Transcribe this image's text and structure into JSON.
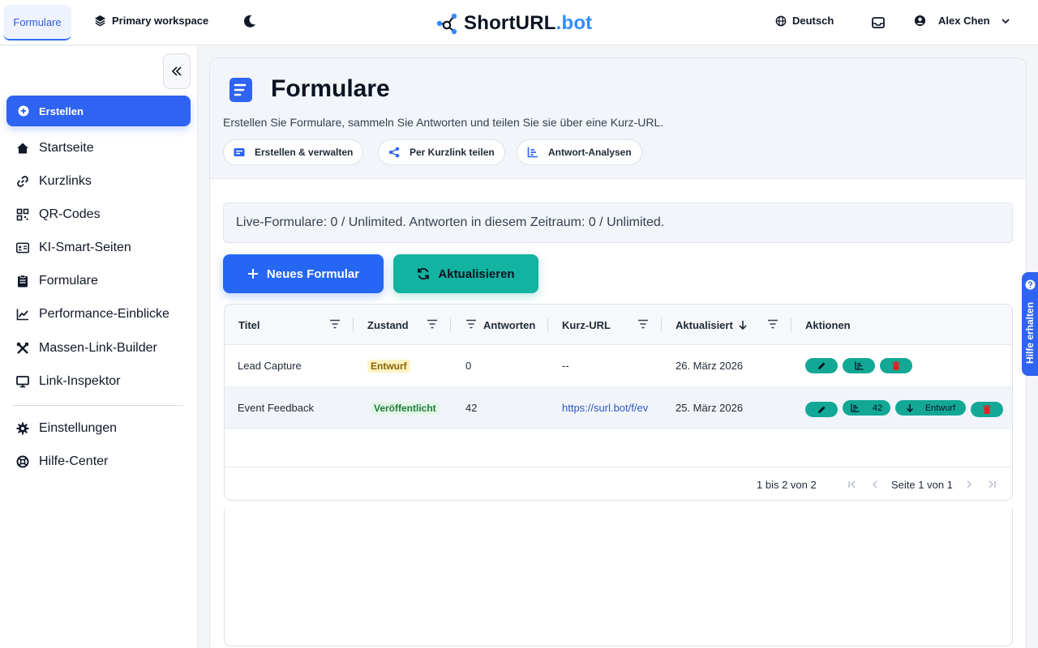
{
  "header": {
    "active_tab": "Formulare",
    "workspace": "Primary workspace",
    "brand_main": "ShortURL",
    "brand_accent": ".bot",
    "language": "Deutsch",
    "user_name": "Alex Chen"
  },
  "sidebar": {
    "create_label": "Erstellen",
    "items": [
      {
        "label": "Startseite",
        "icon": "home-icon"
      },
      {
        "label": "Kurzlinks",
        "icon": "link-icon"
      },
      {
        "label": "QR-Codes",
        "icon": "qr-code-icon"
      },
      {
        "label": "KI-Smart-Seiten",
        "icon": "id-card-icon"
      },
      {
        "label": "Formulare",
        "icon": "clipboard-icon"
      },
      {
        "label": "Performance-Einblicke",
        "icon": "chart-line-icon"
      },
      {
        "label": "Massen-Link-Builder",
        "icon": "tools-icon"
      },
      {
        "label": "Link-Inspektor",
        "icon": "monitor-icon"
      }
    ],
    "bottom_items": [
      {
        "label": "Einstellungen",
        "icon": "gear-icon"
      },
      {
        "label": "Hilfe-Center",
        "icon": "lifebuoy-icon"
      }
    ]
  },
  "page": {
    "title": "Formulare",
    "subtitle": "Erstellen Sie Formulare, sammeln Sie Antworten und teilen Sie sie über eine Kurz-URL.",
    "chips": [
      "Erstellen & verwalten",
      "Per Kurzlink teilen",
      "Antwort-Analysen"
    ],
    "usage_text": "Live-Formulare: 0 / Unlimited. Antworten in diesem Zeitraum: 0 / Unlimited.",
    "new_button": "Neues Formular",
    "refresh_button": "Aktualisieren"
  },
  "table": {
    "columns": [
      "Titel",
      "Zustand",
      "Antworten",
      "Kurz-URL",
      "Aktualisiert",
      "Aktionen"
    ],
    "rows": [
      {
        "title": "Lead Capture",
        "status": "Entwurf",
        "responses": "0",
        "short_url": "--",
        "updated": "26. März 2026"
      },
      {
        "title": "Event Feedback",
        "status": "Veröffentlicht",
        "responses": "42",
        "short_url": "https://surl.bot/f/ev",
        "updated": "25. März 2026",
        "analytics_count": "42",
        "unpublish_label": "Entwurf"
      }
    ],
    "range_text": "1 bis 2 von 2",
    "page_text": "Seite 1 von 1"
  },
  "help_tab": {
    "label": "Hilfe erhalten"
  },
  "colors": {
    "primary": "#2f63f1",
    "teal": "#13a896",
    "draft_bg": "#fdf3c4",
    "published_bg": "#e3f6e8"
  }
}
